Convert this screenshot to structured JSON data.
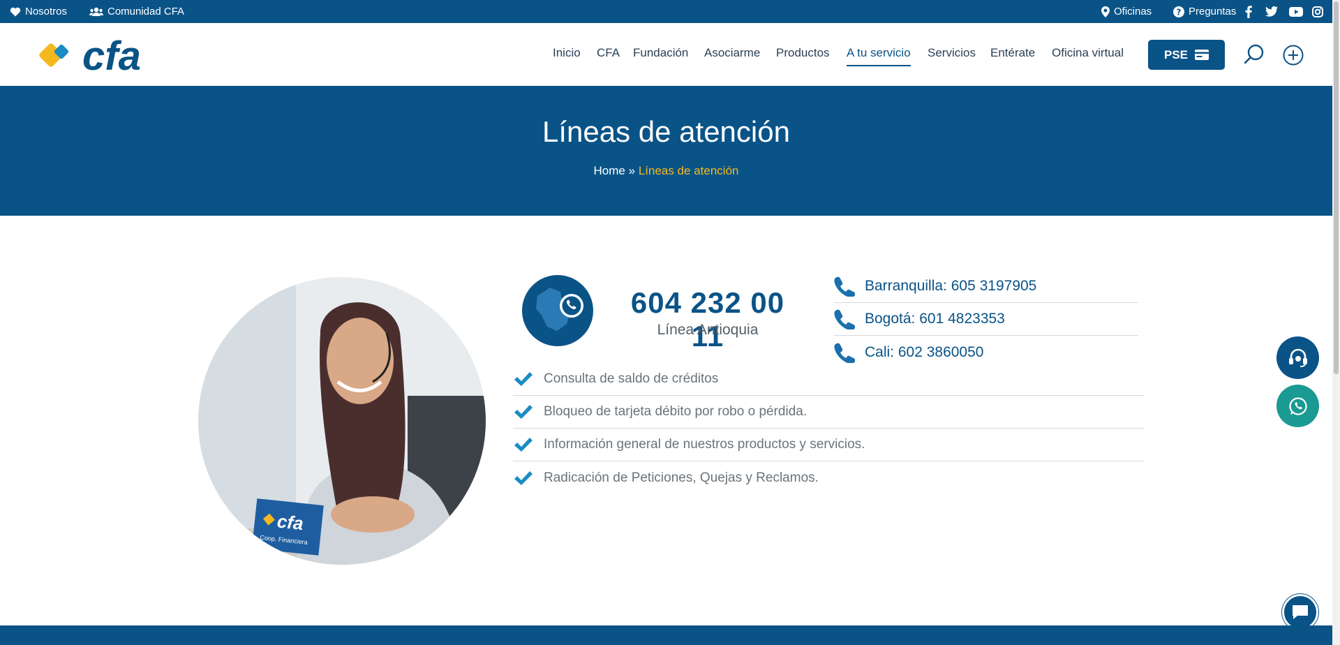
{
  "topbar": {
    "left": [
      {
        "label": "Nosotros",
        "icon": "heart-icon"
      },
      {
        "label": "Comunidad CFA",
        "icon": "users-icon"
      }
    ],
    "right": [
      {
        "label": "Oficinas",
        "icon": "location-pin-icon"
      },
      {
        "label": "Preguntas",
        "icon": "question-circle-icon"
      }
    ],
    "social": [
      "facebook-icon",
      "twitter-icon",
      "youtube-icon",
      "instagram-icon"
    ]
  },
  "header": {
    "logo_text": "cfa",
    "nav": [
      "Inicio",
      "CFA",
      "Fundación",
      "Asociarme",
      "Productos",
      "A tu servicio",
      "Servicios",
      "Entérate",
      "Oficina virtual"
    ],
    "active_nav": "A tu servicio",
    "pse_label": "PSE"
  },
  "hero": {
    "title": "Líneas de atención",
    "breadcrumb_home": "Home",
    "breadcrumb_sep": "»",
    "breadcrumb_current": "Líneas de atención"
  },
  "main_line": {
    "number": "604 232 00 11",
    "label": "Línea Antioquia"
  },
  "other_lines": [
    {
      "label": "Barranquilla: 605 3197905"
    },
    {
      "label": "Bogotá: 601 4823353"
    },
    {
      "label": "Cali: 602 3860050"
    }
  ],
  "services": [
    "Consulta de saldo de créditos",
    "Bloqueo de tarjeta débito por robo o pérdida.",
    "Información general de nuestros productos y servicios.",
    "Radicación de Peticiones, Quejas y Reclamos."
  ],
  "photo_card": {
    "brand": "cfa",
    "sub": "Coop. Financiera"
  },
  "colors": {
    "primary": "#0a5387",
    "accent": "#f5b81f",
    "whatsapp": "#1a9a93",
    "check": "#1a8cc4"
  }
}
